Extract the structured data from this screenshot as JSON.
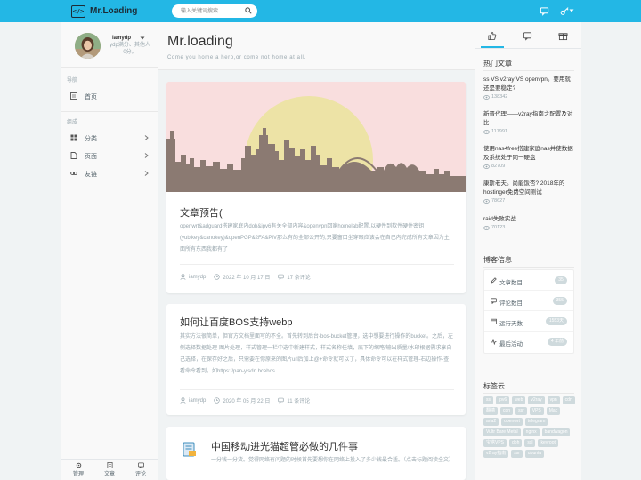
{
  "header": {
    "site_name": "Mr.Loading",
    "logo_glyph": "</>",
    "search_placeholder": "输入关键词搜索…",
    "accent_color": "#23b7e5",
    "icons": [
      "search-icon",
      "chat-icon",
      "key-icon",
      "caret-down-icon"
    ]
  },
  "sidebar": {
    "user_name": "iamydp",
    "user_desc": "ydp满分、其他人0分。",
    "nav_heading": "导航",
    "home_label": "首页",
    "group_heading": "组成",
    "items": [
      {
        "label": "分类",
        "icon": "grid-icon"
      },
      {
        "label": "页面",
        "icon": "file-icon"
      },
      {
        "label": "友链",
        "icon": "link-icon"
      }
    ],
    "footer": [
      {
        "label": "管理",
        "icon": "gear-icon"
      },
      {
        "label": "文章",
        "icon": "document-icon"
      },
      {
        "label": "评论",
        "icon": "comment-icon"
      }
    ]
  },
  "main": {
    "title": "Mr.loading",
    "subtitle": "Come you home a hero,or come not home at all.",
    "posts": [
      {
        "title": "文章预告(",
        "excerpt": "openwrt&adguard搭建家庭内doh&ipv6有关全部内容&openvpn回家homelab配置,以硬件到软件硬件密钥(yubikey&canokey)&openPGP&2FA&PIV那么有的全部公开的,只要窗口坐穿眼应该会在自己内完成所有文章因为主面所有东西我都有了",
        "author": "iamydp",
        "date": "2022 年 10 月 17 日",
        "comments": "17 条评论"
      },
      {
        "title": "如何让百度BOS支持webp",
        "excerpt": "其实方法很简单，但官方文档里面写的不全。首先转到后台-bos-bucket管理，选中想要进行操作的bucket。之后，左侧选择数据处理-图片处理，样式管理一栏中选中新建样式，样式名称任填，底下的缩略/输出质量/水印根据需求享自己选择，在保存好之后，只需要在你原来的图片url后加上@+命令就可以了，具体命令可以在样式管理-右边操作-查看命令看到，如https://pan-y.sdn.bcebos...",
        "author": "iamydp",
        "date": "2020 年 05 月 22 日",
        "comments": "11 条评论"
      },
      {
        "title": "中国移动进光猫超管必做的几件事",
        "excerpt": "一分钱一分货。觉得网络有问题的时候首先要想你在网络上投入了多少钱最合适。（点击标题阅读全文）"
      }
    ]
  },
  "right": {
    "tab_icons": [
      "thumbs-up-icon",
      "comment-icon",
      "gift-icon"
    ],
    "hot_title": "热门文章",
    "hot_posts": [
      {
        "title": "ss VS v2ray VS openvpn。要用就还是要稳定?",
        "views": "138342"
      },
      {
        "title": "新晋代理——v2ray指南之配置及对比",
        "views": "117991"
      },
      {
        "title": "使用nas4free搭建家庭nas并使数据及系统处于同一硬盘",
        "views": "82709"
      },
      {
        "title": "康斯老夫。尚能饭否? 2018年的hostinger免费空间测试",
        "views": "78627"
      },
      {
        "title": "raid失败实战",
        "views": "70123"
      }
    ],
    "info_title": "博客信息",
    "info": [
      {
        "label": "文章数目",
        "value": "35",
        "icon": "pencil-icon"
      },
      {
        "label": "评论数目",
        "value": "355",
        "icon": "comment-icon"
      },
      {
        "label": "运行天数",
        "value": "1553天",
        "icon": "calendar-icon"
      },
      {
        "label": "最后活动",
        "value": "4 年前",
        "icon": "activity-icon"
      }
    ],
    "tag_title": "标签云",
    "tags": [
      "ss",
      "ipv6",
      "web",
      "v2ray",
      "vpn",
      "cdn",
      "翻墙",
      "cdn",
      "ssr",
      "VPS",
      "Mac",
      "aria2",
      "openwrt",
      "telegram",
      "Vultr Bare Metal",
      "nginx",
      "bandwagon",
      "宝塔VPS",
      "doh",
      "ssl",
      "keyroot",
      "v2ray指南",
      "ssr",
      "ubuntu"
    ]
  }
}
